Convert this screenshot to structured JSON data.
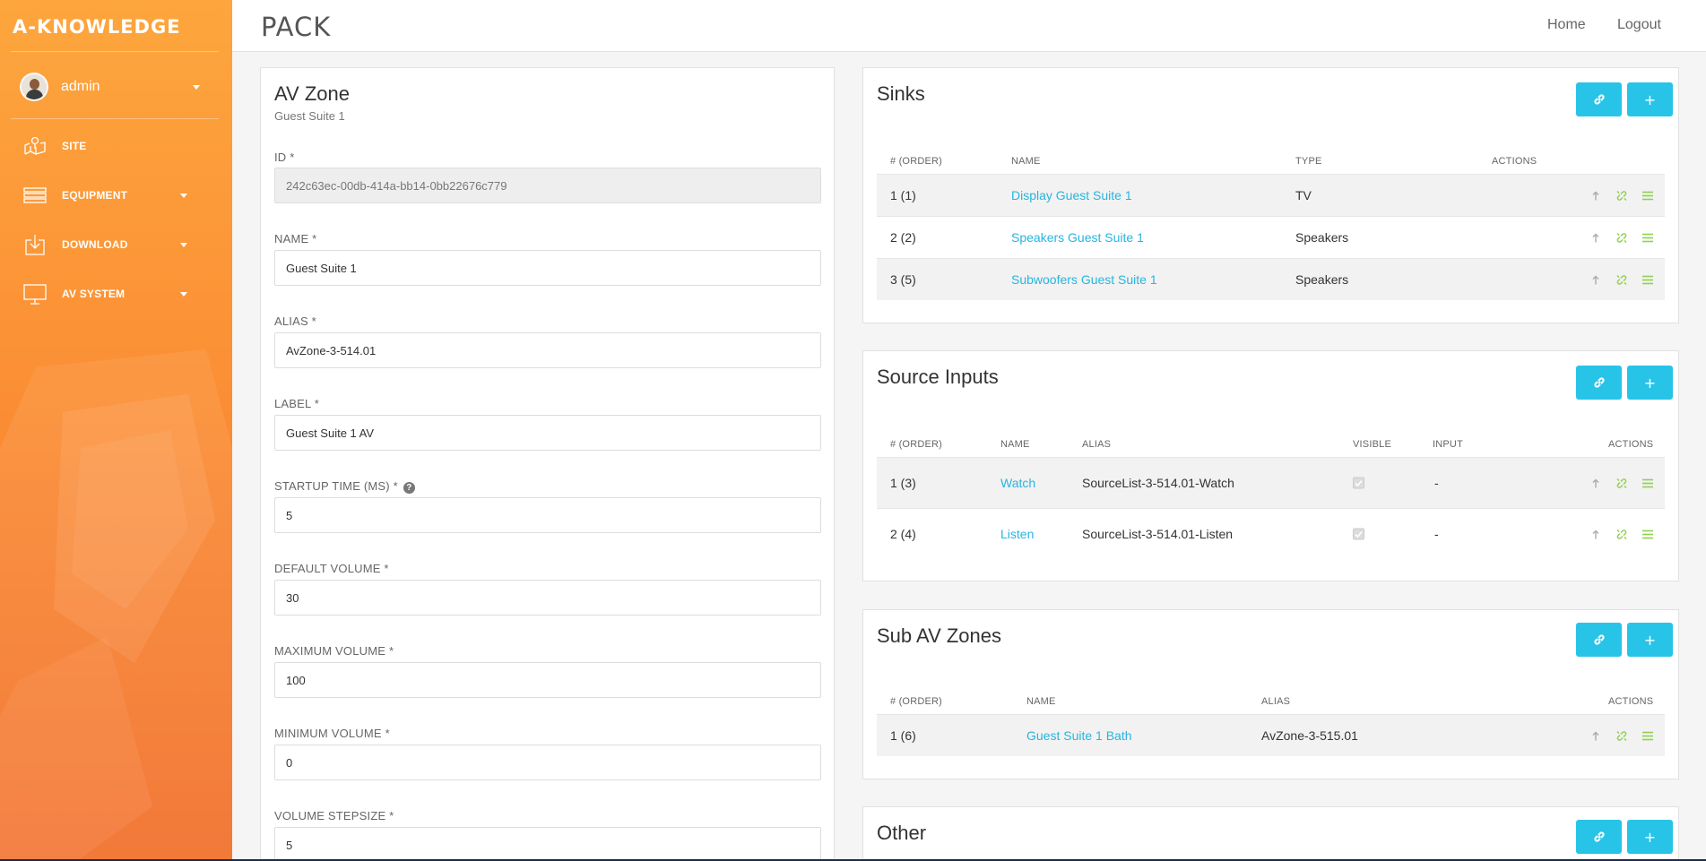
{
  "sidebar": {
    "logo": "A-KNOWLEDGE",
    "user": "admin",
    "items": [
      {
        "label": "SITE"
      },
      {
        "label": "EQUIPMENT"
      },
      {
        "label": "DOWNLOAD"
      },
      {
        "label": "AV SYSTEM"
      }
    ]
  },
  "header": {
    "brand": "PACK",
    "links": {
      "home": "Home",
      "logout": "Logout"
    }
  },
  "form": {
    "title": "AV Zone",
    "subtitle": "Guest Suite 1",
    "fields": [
      {
        "label": "ID *",
        "value": "242c63ec-00db-414a-bb14-0bb22676c779"
      },
      {
        "label": "NAME *",
        "value": "Guest Suite 1"
      },
      {
        "label": "ALIAS *",
        "value": "AvZone-3-514.01"
      },
      {
        "label": "LABEL *",
        "value": "Guest Suite 1 AV"
      },
      {
        "label": "STARTUP TIME (MS) *",
        "value": "5"
      },
      {
        "label": "DEFAULT VOLUME *",
        "value": "30"
      },
      {
        "label": "MAXIMUM VOLUME *",
        "value": "100"
      },
      {
        "label": "MINIMUM VOLUME *",
        "value": "0"
      },
      {
        "label": "VOLUME STEPSIZE *",
        "value": "5"
      }
    ]
  },
  "sinks": {
    "title": "Sinks",
    "headers": [
      "# (ORDER)",
      "NAME",
      "TYPE",
      "ACTIONS"
    ],
    "rows": [
      {
        "order": "1 (1)",
        "name": "Display Guest Suite 1",
        "type": "TV"
      },
      {
        "order": "2 (2)",
        "name": "Speakers Guest Suite 1",
        "type": "Speakers"
      },
      {
        "order": "3 (5)",
        "name": "Subwoofers Guest Suite 1",
        "type": "Speakers"
      }
    ]
  },
  "sources": {
    "title": "Source Inputs",
    "headers": [
      "# (ORDER)",
      "NAME",
      "ALIAS",
      "VISIBLE",
      "INPUT",
      "ACTIONS"
    ],
    "rows": [
      {
        "order": "1 (3)",
        "name": "Watch",
        "alias": "SourceList-3-514.01-Watch",
        "visible": true,
        "input": "-"
      },
      {
        "order": "2 (4)",
        "name": "Listen",
        "alias": "SourceList-3-514.01-Listen",
        "visible": true,
        "input": "-"
      }
    ]
  },
  "subzones": {
    "title": "Sub AV Zones",
    "headers": [
      "# (ORDER)",
      "NAME",
      "ALIAS",
      "ACTIONS"
    ],
    "rows": [
      {
        "order": "1 (6)",
        "name": "Guest Suite 1 Bath",
        "alias": "AvZone-3-515.01"
      }
    ]
  },
  "other": {
    "title": "Other"
  },
  "buttons": {
    "add": "+"
  },
  "icons": {
    "button_left": "link-icon",
    "row_actions": [
      "arrow-up-icon",
      "unlink-icon",
      "menu-icon"
    ],
    "accent": "#27c4e8",
    "action_green": "#8fd14f"
  }
}
